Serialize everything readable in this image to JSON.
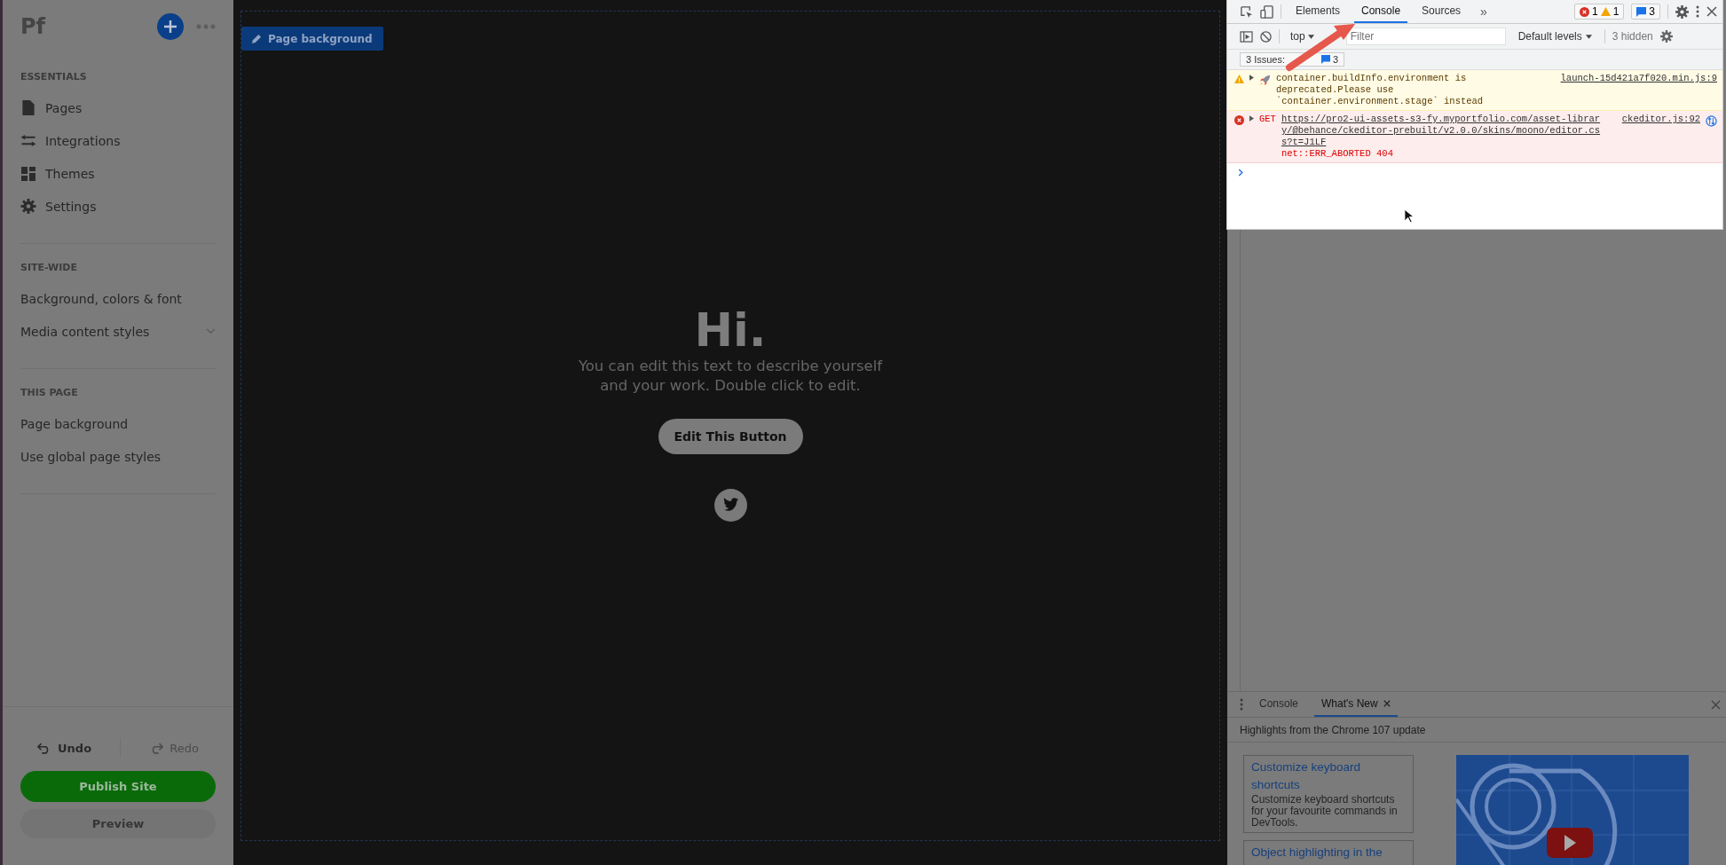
{
  "sidebar": {
    "logo": "Pf",
    "sections": [
      {
        "heading": "ESSENTIALS",
        "items": [
          {
            "label": "Pages",
            "expandable": false
          },
          {
            "label": "Integrations",
            "expandable": false
          },
          {
            "label": "Themes",
            "expandable": false
          },
          {
            "label": "Settings",
            "expandable": false
          }
        ]
      },
      {
        "heading": "SITE-WIDE",
        "items": [
          {
            "label": "Background, colors & font",
            "expandable": false
          },
          {
            "label": "Media content styles",
            "expandable": true
          }
        ]
      },
      {
        "heading": "THIS PAGE",
        "items": [
          {
            "label": "Page background",
            "expandable": false
          },
          {
            "label": "Use global page styles",
            "expandable": false
          }
        ]
      }
    ],
    "undo": {
      "label": "Undo",
      "disabled": false
    },
    "redo": {
      "label": "Redo",
      "disabled": true
    },
    "publish": "Publish Site",
    "preview": "Preview"
  },
  "canvas": {
    "badge": "Page background",
    "heading": "Hi.",
    "text": "You can edit this text to describe yourself and your work. Double click to edit.",
    "button": "Edit This Button"
  },
  "devtools": {
    "tabs": [
      {
        "label": "Elements",
        "selected": false
      },
      {
        "label": "Console",
        "selected": true
      },
      {
        "label": "Sources",
        "selected": false
      }
    ],
    "more": "»",
    "counts": {
      "errors": "1",
      "warnings": "1",
      "messages": "3"
    },
    "context": "top",
    "filter_placeholder": "Filter",
    "levels": "Default levels",
    "hidden": "3 hidden",
    "issues": {
      "label": "3 Issues:",
      "count": "3"
    },
    "messages": [
      {
        "kind": "warning",
        "text": "container.buildInfo.environment is deprecated.Please use `container.environment.stage` instead",
        "source": "launch-15d421a7f020.min.js:9"
      },
      {
        "kind": "error",
        "method": "GET",
        "url": "https://pro2-ui-assets-s3-fy.myportfolio.com/asset-library/@behance/ckeditor-prebuilt/v2.0.0/skins/moono/editor.css?t=J1LF",
        "status": "net::ERR_ABORTED 404",
        "source": "ckeditor.js:92"
      }
    ]
  },
  "drawer": {
    "tabs": [
      {
        "label": "Console",
        "selected": false,
        "closable": false
      },
      {
        "label": "What's New",
        "selected": true,
        "closable": true
      }
    ],
    "headline": "Highlights from the Chrome 107 update",
    "cards": [
      {
        "title": "Customize keyboard shortcuts",
        "text": "Customize keyboard shortcuts for your favourite commands in DevTools."
      },
      {
        "title": "Object highlighting in the"
      }
    ]
  }
}
